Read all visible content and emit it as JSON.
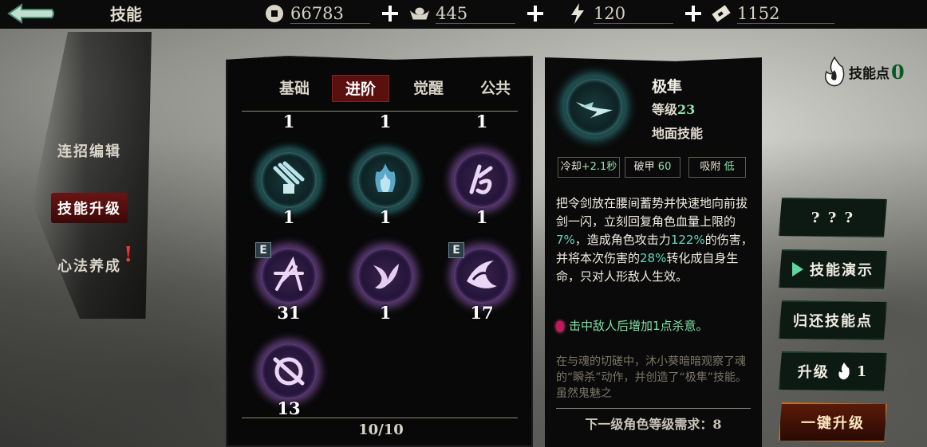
{
  "header": {
    "title": "技能",
    "resources": [
      {
        "icon": "coin-icon",
        "value": "66783"
      },
      {
        "icon": "silver-ingot-icon",
        "value": "445"
      },
      {
        "icon": "lightning-icon",
        "value": "120"
      },
      {
        "icon": "ticket-icon",
        "value": "1152"
      }
    ]
  },
  "left_menu": {
    "items": [
      {
        "label": "连招编辑",
        "active": false
      },
      {
        "label": "技能升级",
        "active": true
      },
      {
        "label": "心法养成",
        "active": false
      }
    ],
    "alert": "!"
  },
  "skill_panel": {
    "tabs": [
      "基础",
      "进阶",
      "觉醒",
      "公共"
    ],
    "active_tab": 1,
    "top_row_levels": [
      "1",
      "1",
      "1"
    ],
    "skills": [
      {
        "icon": "claw-slash-icon",
        "style": "teal",
        "level": "1",
        "badge": ""
      },
      {
        "icon": "flame-burst-icon",
        "style": "teal",
        "level": "1",
        "badge": ""
      },
      {
        "icon": "rune-sigil-icon",
        "style": "purple",
        "level": "1",
        "badge": ""
      },
      {
        "icon": "cross-strike-icon",
        "style": "purple",
        "level": "31",
        "badge": "E"
      },
      {
        "icon": "phoenix-wing-icon",
        "style": "purple",
        "level": "1",
        "badge": ""
      },
      {
        "icon": "dark-wave-icon",
        "style": "purple",
        "level": "17",
        "badge": "E"
      },
      {
        "icon": "spin-slash-icon",
        "style": "purple",
        "level": "13",
        "badge": ""
      }
    ],
    "pager": "10/10"
  },
  "detail": {
    "icon": "swift-strike-icon",
    "name": "极隼",
    "level_label": "等级",
    "level_value": "23",
    "type": "地面技能",
    "stats": {
      "cooldown_label": "冷却",
      "cooldown_value": "+2.1秒",
      "armor_break_label": "破甲",
      "armor_break_value": "60",
      "absorb_label": "吸附",
      "absorb_value": "低"
    },
    "desc_parts": [
      "把令剑放在腰间蓄势并快速地向前拔剑一闪，立刻回复角色血量上限的",
      "7%",
      "，造成角色攻击力",
      "122%",
      "的伤害，并将本次伤害的",
      "28%",
      "转化成自身生命，只对人形敌人生效。"
    ],
    "bonus": "击中敌人后增加1点杀意。",
    "lore": "在与魂的切磋中，沐小葵暗暗观察了魂的“瞬杀”动作，并创造了“极隼”技能。虽然鬼魅之",
    "requirement": "下一级角色等级需求：8"
  },
  "right": {
    "skill_points_label": "技能点",
    "skill_points_value": "0",
    "btn_unknown": "? ? ?",
    "btn_demo": "技能演示",
    "btn_refund": "归还技能点",
    "btn_upgrade_label": "升级",
    "btn_upgrade_cost": "1",
    "btn_one_click": "一键升级"
  },
  "colors": {
    "accent_red": "#5b1010",
    "teal_glow": "#2a6e72",
    "purple_glow": "#5a3c70",
    "highlight_teal": "#5fd6c2",
    "green_text": "#7fe0a8"
  }
}
